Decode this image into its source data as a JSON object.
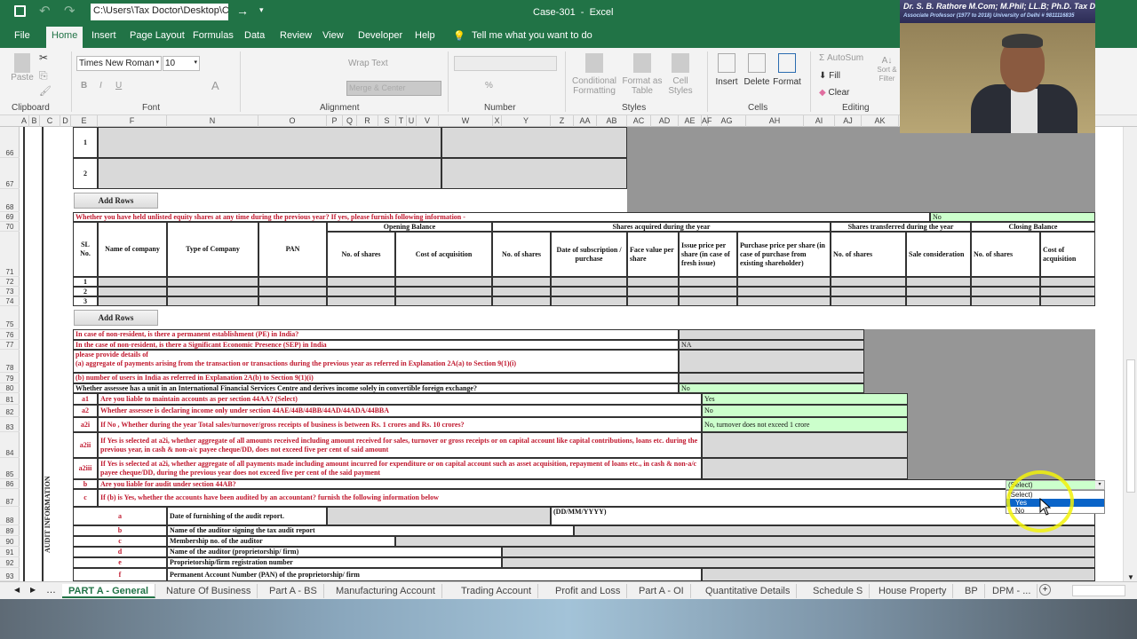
{
  "titlebar": {
    "path_box": "C:\\Users\\Tax Doctor\\Desktop\\C:",
    "title": "Case-301  -  Excel"
  },
  "ribbon_tabs": [
    "File",
    "Home",
    "Insert",
    "Page Layout",
    "Formulas",
    "Data",
    "Review",
    "View",
    "Developer",
    "Help"
  ],
  "tell_me": "Tell me what you want to do",
  "ribbon": {
    "paste": "Paste",
    "font_name": "Times New Roman",
    "font_size": "10",
    "wrap_text": "Wrap Text",
    "merge_center": "Merge & Center",
    "conditional": "Conditional Formatting",
    "format_table": "Format as Table",
    "cell_styles": "Cell Styles",
    "insert": "Insert",
    "delete": "Delete",
    "format": "Format",
    "autosum": "AutoSum",
    "fill": "Fill",
    "clear": "Clear",
    "sort": "Sort & Filter",
    "groups": {
      "clipboard": "Clipboard",
      "font": "Font",
      "alignment": "Alignment",
      "number": "Number",
      "styles": "Styles",
      "cells": "Cells",
      "editing": "Editing"
    }
  },
  "columns": [
    "A",
    "B",
    "C",
    "D",
    "E",
    "F",
    "N",
    "O",
    "P",
    "Q",
    "R",
    "S",
    "T",
    "U",
    "V",
    "W",
    "X",
    "Y",
    "Z",
    "AA",
    "AB",
    "AC",
    "AD",
    "AE",
    "AF",
    "AG",
    "AH",
    "AI",
    "AJ",
    "AK"
  ],
  "rows": [
    "66",
    "67",
    "68",
    "69",
    "70",
    "71",
    "72",
    "73",
    "74",
    "75",
    "76",
    "77",
    "78",
    "79",
    "80",
    "81",
    "82",
    "83",
    "84",
    "85",
    "86",
    "87",
    "88",
    "89",
    "90",
    "91",
    "92",
    "93"
  ],
  "sheet": {
    "r66_no": "1",
    "r67_no": "2",
    "add_rows": "Add Rows",
    "q69": "Whether you have held unlisted equity shares at any time during the previous year? If yes, please furnish following information -",
    "a69": "No",
    "hdr": {
      "sl": "SL No.",
      "name": "Name of company",
      "type": "Type of Company",
      "pan": "PAN",
      "opening": "Opening Balance",
      "acquired": "Shares acquired during the year",
      "transferred": "Shares transferred during the year",
      "closing": "Closing Balance",
      "no_shares": "No. of shares",
      "cost": "Cost of acquisition",
      "date_sub": "Date of subscription  /  purchase",
      "face": "Face value per share",
      "issue": "Issue price per share (in case of fresh issue)",
      "purchase": "Purchase price per share (in case of purchase from existing shareholder)",
      "sale": "Sale consideration"
    },
    "r72": "1",
    "r73": "2",
    "r74": "3",
    "q76": "In case of non-resident, is there a permanent establishment (PE) in India?",
    "q77": "In the case of non-resident, is there a Significant Economic Presence (SEP) in India",
    "a77": "NA",
    "q78a": "please provide details of",
    "q78b": "(a)   aggregate of payments arising from the transaction or transactions during the previous year as referred in Explanation 2A(a) to Section 9(1)(i)",
    "q79": "(b)  number of users in India as referred in Explanation 2A(b) to Section 9(1)(i)",
    "q80": "Whether assessee has a unit in an International Financial Services Centre and derives income solely in convertible foreign exchange?",
    "a80": "No",
    "audit_label": "AUDIT INFORMATION",
    "c81": "a1",
    "q81": "Are you liable to maintain accounts as per section 44AA? (Select)",
    "a81": "Yes",
    "c82": "a2",
    "q82": "Whether assessee is declaring income only under section 44AE/44B/44BB/44AD/44ADA/44BBA",
    "a82": "No",
    "c83": "a2i",
    "q83": "If  No , Whether during the year Total sales/turnover/gross receipts of business is between Rs. 1 crores and Rs. 10 crores?",
    "a83": "No, turnover does not exceed 1 crore",
    "c84": "a2ii",
    "q84": "If Yes is selected at a2i, whether aggregate of all amounts received including amount received for sales, turnover or gross receipts or on capital account like capital contributions, loans etc.  during the previous year, in cash & non-a/c payee cheque/DD, does not exceed five per cent of said amount",
    "c85": "a2iii",
    "q85": "If Yes is selected at a2i, whether aggregate of all payments made including amount incurred for expenditure or on capital account such as asset acquisition, repayment of loans etc.,  in cash & non-a/c payee cheque/DD,  during the previous year does not exceed five per cent of the said payment",
    "c86": "b",
    "q86": "Are you liable for audit under section 44AB?",
    "c87": "c",
    "q87": "If (b) is Yes, whether the accounts have been audited by an accountant? furnish the following information below",
    "c88": "a",
    "q88": "Date of furnishing of the audit report.",
    "fmt88": "(DD/MM/YYYY)",
    "c89": "b",
    "q89": "Name of the auditor signing the tax audit report",
    "c90": "c",
    "q90": "Membership no. of the auditor",
    "c91": "d",
    "q91": "Name of the auditor (proprietorship/ firm)",
    "c92": "e",
    "q92": "Proprietorship/firm registration number",
    "c93": "f",
    "q93": "Permanent Account Number (PAN) of the proprietorship/ firm"
  },
  "dropdown": {
    "value": "(Select)",
    "options": [
      "(Select)",
      "Yes",
      "No"
    ],
    "highlighted": "Yes"
  },
  "sheet_tabs": [
    "PART A - General",
    "Nature Of Business",
    "Part A - BS",
    "Manufacturing Account",
    "Trading Account",
    "Profit and Loss",
    "Part A - OI",
    "Quantitative Details",
    "Schedule S",
    "House Property",
    "BP",
    "DPM - ..."
  ],
  "active_sheet": "PART A - General",
  "webcam": {
    "banner_line1": "Dr. S. B. Rathore  M.Com; M.Phil; LL.B; Ph.D.  Tax Doctor",
    "banner_line2": "Associate Professor (1977 to 2018) University of Delhi # 9811116835"
  },
  "colors": {
    "excel_green": "#217346",
    "input_green": "#ccffcc",
    "locked_gray": "#d9d9d9",
    "question_red": "#c0182e",
    "highlight_circle": "#f2f20a"
  }
}
